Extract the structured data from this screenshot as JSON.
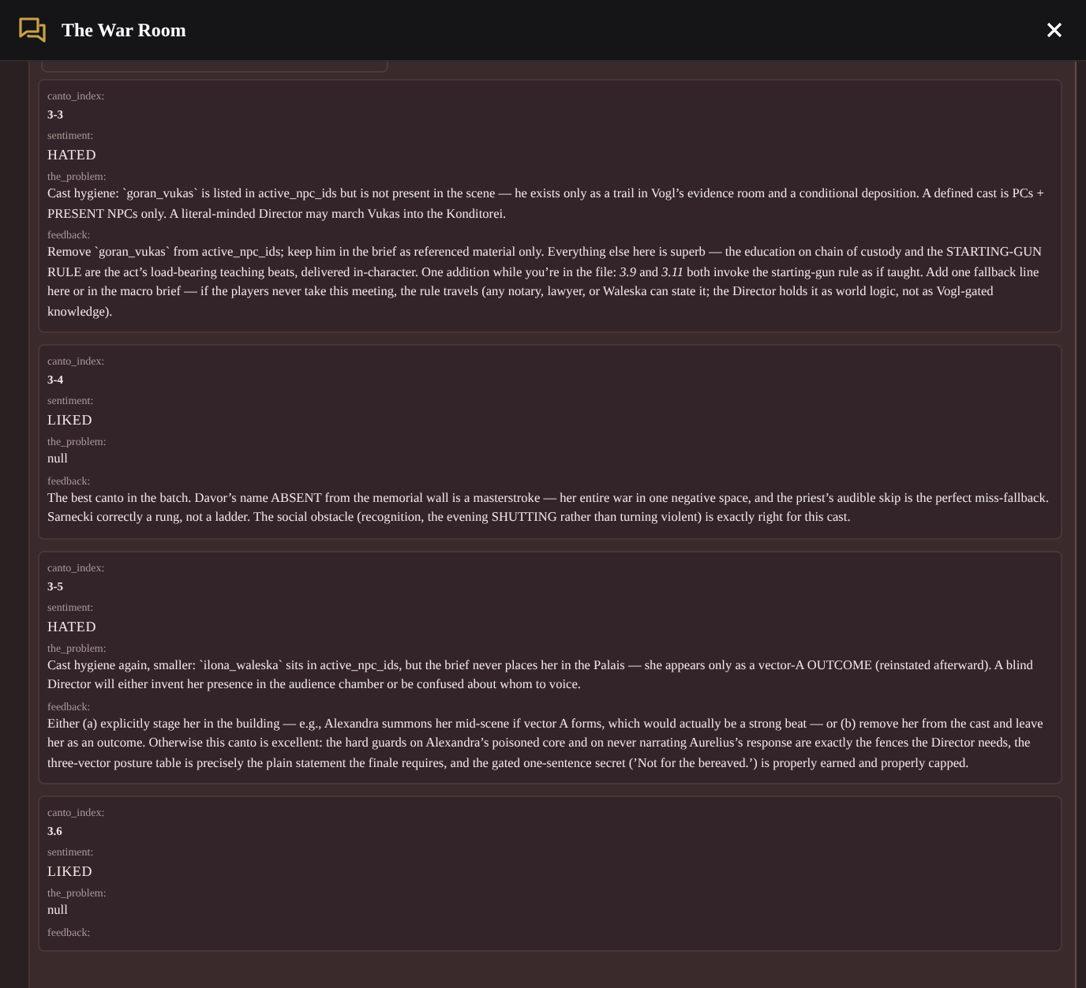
{
  "window": {
    "title": "The War Room"
  },
  "cards": [
    {
      "fields": [
        {
          "label": "canto_index:",
          "value": "3-3",
          "kind": "index"
        },
        {
          "label": "sentiment:",
          "value": "HATED",
          "kind": "sentiment"
        },
        {
          "label": "the_problem:",
          "value": "Cast hygiene: `goran_vukas` is listed in active_npc_ids but is not present in the scene — he exists only as a trail in Vogl’s evidence room and a conditional deposition. A defined cast is PCs + PRESENT NPCs only. A literal-minded Director may march Vukas into the Konditorei.",
          "kind": "text"
        },
        {
          "label": "feedback:",
          "value": "Remove `goran_vukas` from active_npc_ids; keep him in the brief as referenced material only. Everything else here is superb — the education on chain of custody and the STARTING-GUN RULE are the act’s load-bearing teaching beats, delivered in-character. One addition while you’re in the file: *3.9* and *3.11* both invoke the starting-gun rule as if taught. Add one fallback line here or in the macro brief — if the players never take this meeting, the rule travels (any notary, lawyer, or Waleska can state it; the Director holds it as world logic, not as Vogl-gated knowledge).",
          "kind": "text"
        }
      ]
    },
    {
      "fields": [
        {
          "label": "canto_index:",
          "value": "3-4",
          "kind": "index"
        },
        {
          "label": "sentiment:",
          "value": "LIKED",
          "kind": "sentiment"
        },
        {
          "label": "the_problem:",
          "value": "null",
          "kind": "text"
        },
        {
          "label": "feedback:",
          "value": "The best canto in the batch. Davor’s name ABSENT from the memorial wall is a masterstroke — her entire war in one negative space, and the priest’s audible skip is the perfect miss-fallback. Sarnecki correctly a rung, not a ladder. The social obstacle (recognition, the evening SHUTTING rather than turning violent) is exactly right for this cast.",
          "kind": "text"
        }
      ]
    },
    {
      "fields": [
        {
          "label": "canto_index:",
          "value": "3-5",
          "kind": "index"
        },
        {
          "label": "sentiment:",
          "value": "HATED",
          "kind": "sentiment"
        },
        {
          "label": "the_problem:",
          "value": "Cast hygiene again, smaller: `ilona_waleska` sits in active_npc_ids, but the brief never places her in the Palais — she appears only as a vector-A OUTCOME (reinstated afterward). A blind Director will either invent her presence in the audience chamber or be confused about whom to voice.",
          "kind": "text"
        },
        {
          "label": "feedback:",
          "value": "Either (a) explicitly stage her in the building — e.g., Alexandra summons her mid-scene if vector A forms, which would actually be a strong beat — or (b) remove her from the cast and leave her as an outcome. Otherwise this canto is excellent: the hard guards on Alexandra’s poisoned core and on never narrating Aurelius’s response are exactly the fences the Director needs, the three-vector posture table is precisely the plain statement the finale requires, and the gated one-sentence secret (’Not for the bereaved.’) is properly earned and properly capped.",
          "kind": "text"
        }
      ]
    },
    {
      "fields": [
        {
          "label": "canto_index:",
          "value": "3.6",
          "kind": "index"
        },
        {
          "label": "sentiment:",
          "value": "LIKED",
          "kind": "sentiment"
        },
        {
          "label": "the_problem:",
          "value": "null",
          "kind": "text"
        },
        {
          "label": "feedback:"
        }
      ]
    }
  ]
}
